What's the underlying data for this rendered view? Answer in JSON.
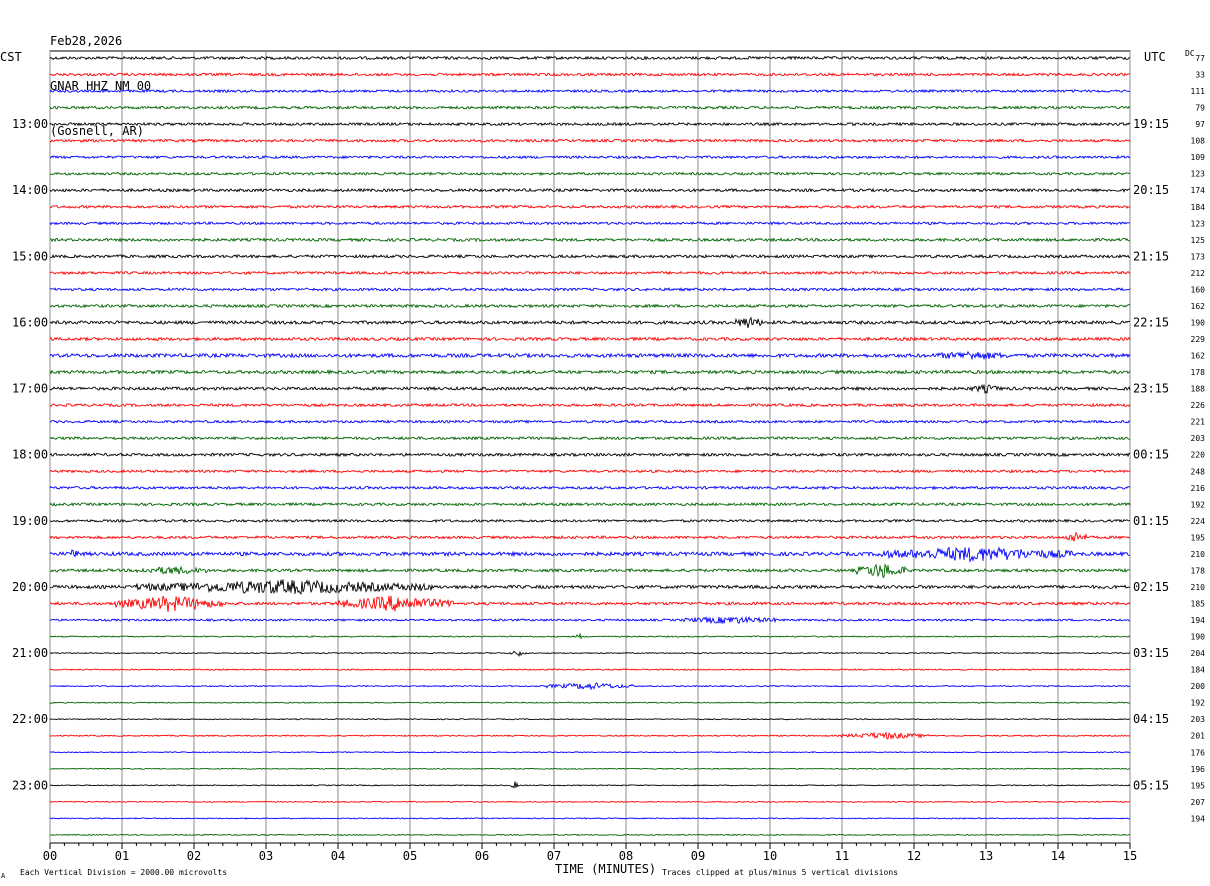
{
  "header": {
    "date": "Feb28,2026",
    "station": "GNAR HHZ NM 00",
    "location": "(Gosnell, AR)"
  },
  "footer": {
    "scale_note": "Each Vertical Division = 2000.00 microvolts",
    "clip_note": "Traces clipped at plus/minus 5 vertical divisions",
    "corner_mark": "A"
  },
  "chart_data": {
    "type": "line",
    "title": "GNAR HHZ NM 00",
    "xlabel": "TIME (MINUTES)",
    "left_axis_label": "CST",
    "right_axis_label": "UTC",
    "dc_label": "DC",
    "xlim": [
      0,
      15
    ],
    "x_ticks": [
      "00",
      "01",
      "02",
      "03",
      "04",
      "05",
      "06",
      "07",
      "08",
      "09",
      "10",
      "11",
      "12",
      "13",
      "14",
      "15"
    ],
    "minutes_per_trace": 15,
    "trace_count": 48,
    "trace_colors": [
      "#000000",
      "#ff0000",
      "#0000ff",
      "#006400"
    ],
    "grid": true,
    "cst_hour_labels": [
      "13:00",
      "14:00",
      "15:00",
      "16:00",
      "17:00",
      "18:00",
      "19:00",
      "20:00",
      "21:00",
      "22:00",
      "23:00"
    ],
    "utc_hour_labels": [
      "19:15",
      "20:15",
      "21:15",
      "22:15",
      "23:15",
      "00:15",
      "01:15",
      "02:15",
      "03:15",
      "04:15",
      "05:15"
    ],
    "dc_offsets": [
      77,
      33,
      111,
      79,
      97,
      108,
      109,
      123,
      174,
      184,
      123,
      125,
      173,
      212,
      160,
      162,
      190,
      229,
      162,
      178,
      188,
      226,
      221,
      203,
      220,
      248,
      216,
      192,
      224,
      195,
      210,
      178,
      210,
      185,
      194,
      190,
      204,
      184,
      200,
      192,
      203,
      201,
      176,
      196,
      195,
      207,
      194
    ],
    "trace_amplitude": [
      1.4,
      1.3,
      1.2,
      1.3,
      1.3,
      1.3,
      1.2,
      1.2,
      1.4,
      1.3,
      1.2,
      1.4,
      1.4,
      1.3,
      1.3,
      1.4,
      1.6,
      1.5,
      1.8,
      1.6,
      1.5,
      1.3,
      1.2,
      1.3,
      1.4,
      1.2,
      1.3,
      1.3,
      1.2,
      1.3,
      1.8,
      1.4,
      1.6,
      1.4,
      1.0,
      0.6,
      0.5,
      0.6,
      0.6,
      0.5,
      0.5,
      0.6,
      0.5,
      0.5,
      0.5,
      0.5,
      0.5,
      0.5
    ],
    "events": [
      {
        "trace": 16,
        "start_min": 9.5,
        "end_min": 9.9,
        "amp": 5
      },
      {
        "trace": 18,
        "start_min": 12.3,
        "end_min": 13.3,
        "amp": 3
      },
      {
        "trace": 20,
        "start_min": 12.8,
        "end_min": 13.2,
        "amp": 3
      },
      {
        "trace": 29,
        "start_min": 14.1,
        "end_min": 14.4,
        "amp": 5
      },
      {
        "trace": 30,
        "start_min": 0.3,
        "end_min": 0.4,
        "amp": 6
      },
      {
        "trace": 30,
        "start_min": 11.5,
        "end_min": 14.2,
        "amp": 6
      },
      {
        "trace": 31,
        "start_min": 11.2,
        "end_min": 11.9,
        "amp": 7
      },
      {
        "trace": 31,
        "start_min": 1.2,
        "end_min": 2.2,
        "amp": 3
      },
      {
        "trace": 32,
        "start_min": 1.2,
        "end_min": 5.3,
        "amp": 6
      },
      {
        "trace": 33,
        "start_min": 0.9,
        "end_min": 2.4,
        "amp": 7
      },
      {
        "trace": 33,
        "start_min": 4.0,
        "end_min": 5.6,
        "amp": 7
      },
      {
        "trace": 34,
        "start_min": 8.8,
        "end_min": 10.1,
        "amp": 3
      },
      {
        "trace": 35,
        "start_min": 7.3,
        "end_min": 7.4,
        "amp": 3
      },
      {
        "trace": 36,
        "start_min": 6.4,
        "end_min": 6.6,
        "amp": 3
      },
      {
        "trace": 38,
        "start_min": 6.9,
        "end_min": 8.1,
        "amp": 3
      },
      {
        "trace": 41,
        "start_min": 11.0,
        "end_min": 12.2,
        "amp": 3
      },
      {
        "trace": 44,
        "start_min": 6.4,
        "end_min": 6.5,
        "amp": 4
      }
    ]
  }
}
